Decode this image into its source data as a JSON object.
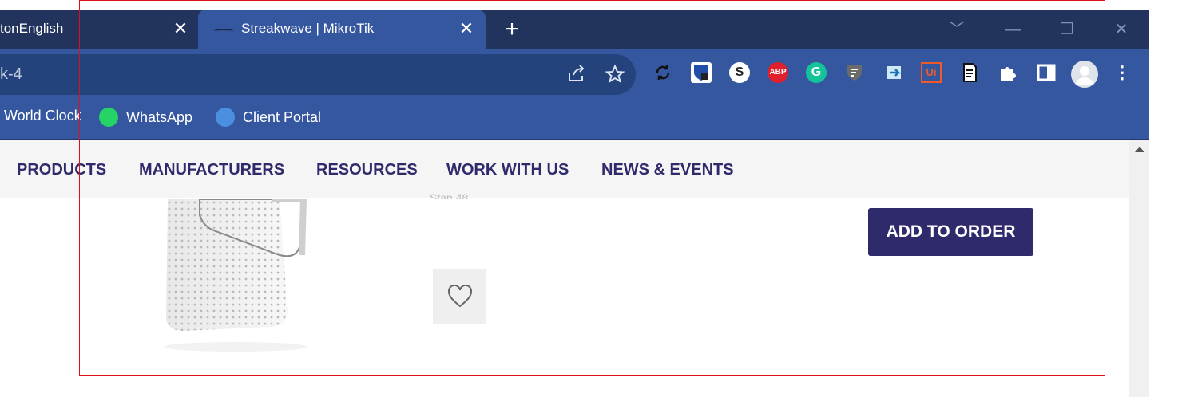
{
  "browser": {
    "tabs": [
      {
        "title": "tonEnglish",
        "active": false
      },
      {
        "title": "Streakwave | MikroTik",
        "active": true
      }
    ],
    "close_glyph": "✕",
    "new_tab_glyph": "+",
    "address": "k-4",
    "bookmarks": [
      {
        "label": "World Clock",
        "icon": "clock-icon"
      },
      {
        "label": "WhatsApp",
        "icon": "whatsapp-icon",
        "color": "#25d366"
      },
      {
        "label": "Client Portal",
        "icon": "globe-icon",
        "color": "#4a8fe0"
      }
    ],
    "extensions": [
      {
        "name": "sync-icon",
        "color": "#1b1b1b"
      },
      {
        "name": "bitwarden-icon",
        "color": "#1f4fa8"
      },
      {
        "name": "s-extension-icon",
        "color": "#ffffff",
        "text": "S"
      },
      {
        "name": "adblock-plus-icon",
        "color": "#e0202a",
        "text": "ABP"
      },
      {
        "name": "grammarly-icon",
        "color": "#15c39a",
        "text": "G"
      },
      {
        "name": "shield-icon",
        "color": "#6b6b6b"
      },
      {
        "name": "arrow-extension-icon",
        "color": "#7dd3f0"
      },
      {
        "name": "uipath-icon",
        "color": "#f05a28",
        "text": "Ui"
      },
      {
        "name": "document-icon",
        "color": "#222b45"
      },
      {
        "name": "puzzle-icon",
        "color": "#ffffff"
      },
      {
        "name": "sidepanel-icon",
        "color": "#ffffff"
      }
    ]
  },
  "site": {
    "nav": [
      "PRODUCTS",
      "MANUFACTURERS",
      "RESOURCES",
      "WORK WITH US",
      "NEWS & EVENTS"
    ],
    "stub_text": "Stan 48",
    "add_to_order": "ADD TO ORDER"
  },
  "colors": {
    "nav_text": "#2e2a6b",
    "button_bg": "#2e2a6b",
    "chrome_dark": "#22335d",
    "chrome_light": "#3557a0",
    "highlight": "#e0101a"
  }
}
